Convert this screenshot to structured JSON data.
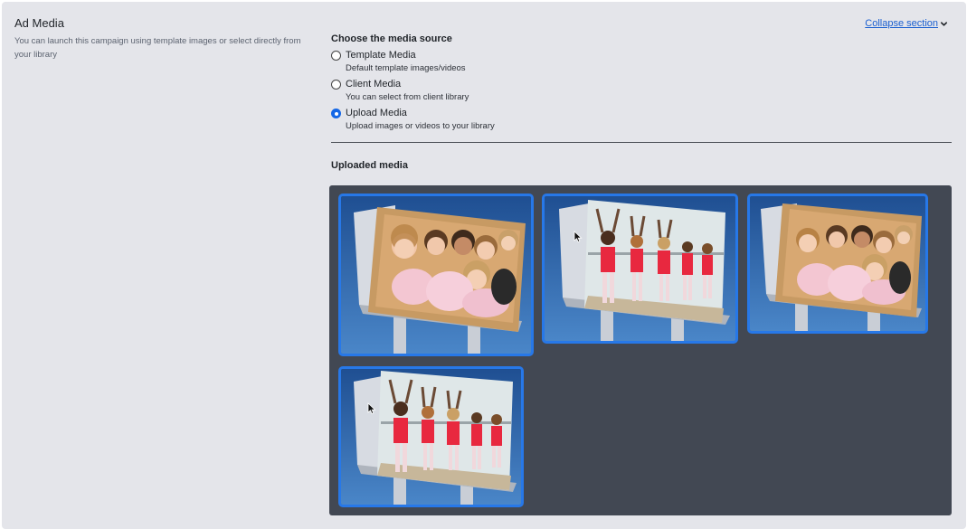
{
  "section": {
    "title": "Ad Media",
    "description": "You can launch this campaign using template images or select directly from your library",
    "collapse_label": "Collapse section"
  },
  "source": {
    "heading": "Choose the media source",
    "selected": "upload",
    "options": [
      {
        "id": "template",
        "label": "Template Media",
        "description": "Default template images/videos",
        "checked": false
      },
      {
        "id": "client",
        "label": "Client Media",
        "description": "You can select from client library",
        "checked": false
      },
      {
        "id": "upload",
        "label": "Upload Media",
        "description": "Upload images or videos to your library",
        "checked": true
      }
    ]
  },
  "uploaded": {
    "heading": "Uploaded media",
    "items": [
      {
        "subject": "girls-group-billboard"
      },
      {
        "subject": "ballet-dancers-billboard"
      },
      {
        "subject": "girls-group-billboard"
      },
      {
        "subject": "ballet-dancers-billboard"
      }
    ]
  },
  "colors": {
    "accent": "#2778e8",
    "link": "#1a5fd0",
    "panel_bg": "#e4e5ea",
    "grid_bg": "#424853"
  }
}
